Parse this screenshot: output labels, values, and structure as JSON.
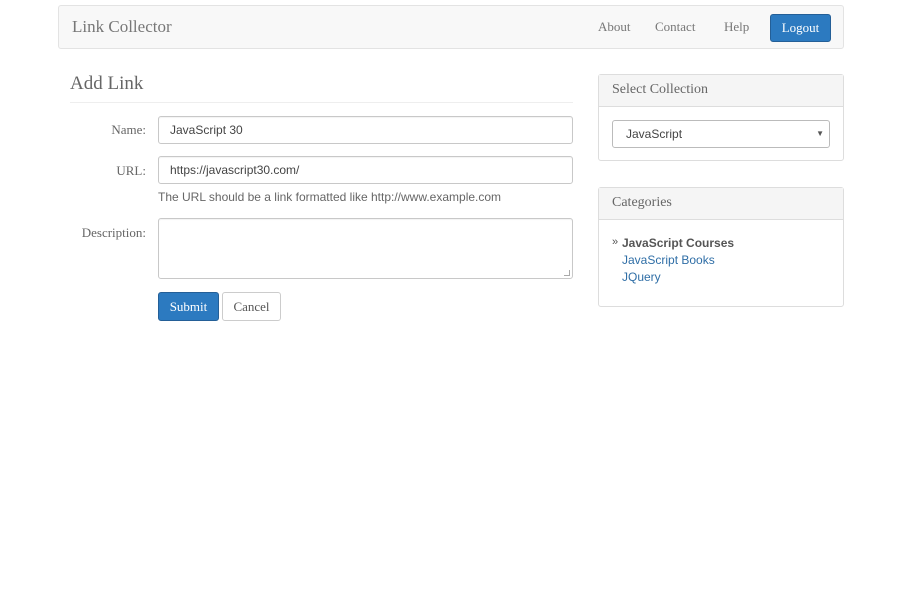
{
  "navbar": {
    "brand": "Link Collector",
    "links": [
      "About",
      "Contact",
      "Help"
    ],
    "logout_label": "Logout"
  },
  "form": {
    "title": "Add Link",
    "name_label": "Name:",
    "name_value": "JavaScript 30",
    "url_label": "URL:",
    "url_value": "https://javascript30.com/",
    "url_help": "The URL should be a link formatted like http://www.example.com",
    "description_label": "Description:",
    "description_value": "",
    "submit_label": "Submit",
    "cancel_label": "Cancel"
  },
  "collection_panel": {
    "title": "Select Collection",
    "selected": "JavaScript"
  },
  "categories_panel": {
    "title": "Categories",
    "items": [
      {
        "label": "JavaScript Courses",
        "active": true
      },
      {
        "label": "JavaScript Books",
        "active": false
      },
      {
        "label": "JQuery",
        "active": false
      }
    ]
  },
  "colors": {
    "primary": "#2c7ac0",
    "link": "#2f6ea6",
    "navbar_bg": "#f8f8f8"
  }
}
